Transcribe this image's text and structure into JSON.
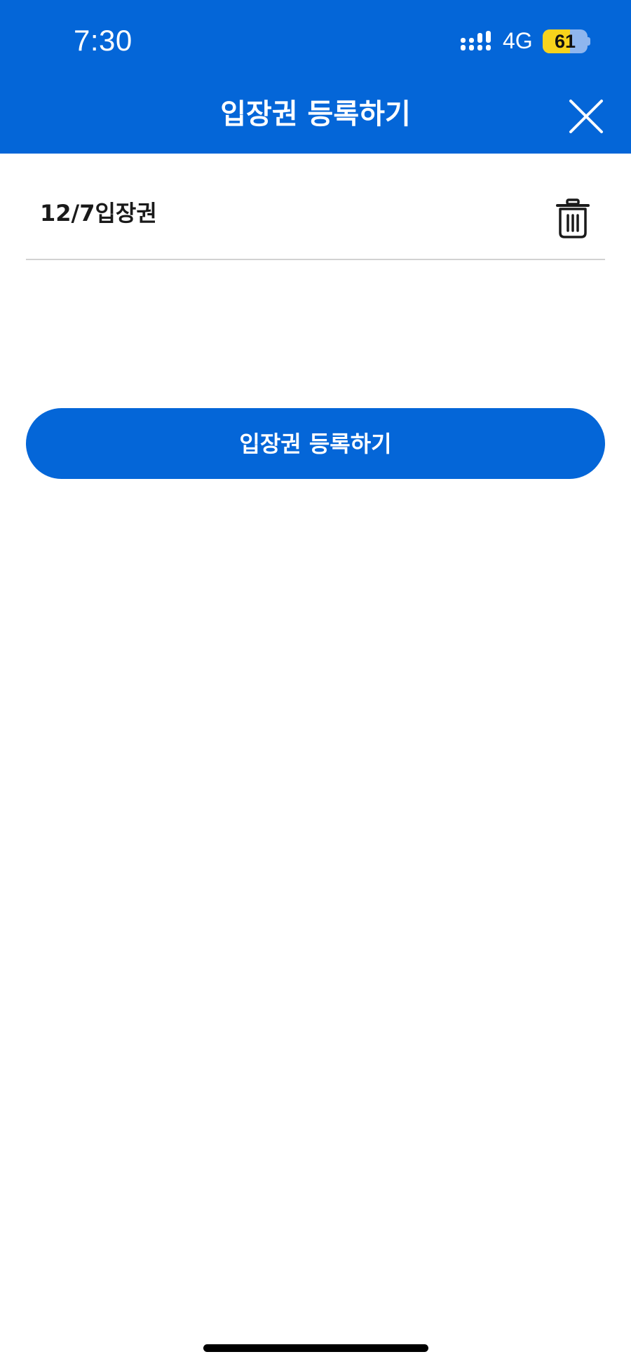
{
  "status_bar": {
    "time": "7:30",
    "network": "4G",
    "battery_level": "61",
    "signal_icon": "cellular-signal-icon",
    "battery_fill_fraction": 0.61,
    "battery_fill_color": "#f7d31c"
  },
  "header": {
    "title": "입장권 등록하기",
    "close_icon": "close-icon",
    "background_color": "#0466d8"
  },
  "ticket_list": [
    {
      "name": "12/7입장권",
      "delete_icon": "trash-icon"
    }
  ],
  "register_button": {
    "label": "입장권 등록하기",
    "color": "#0466d8"
  }
}
